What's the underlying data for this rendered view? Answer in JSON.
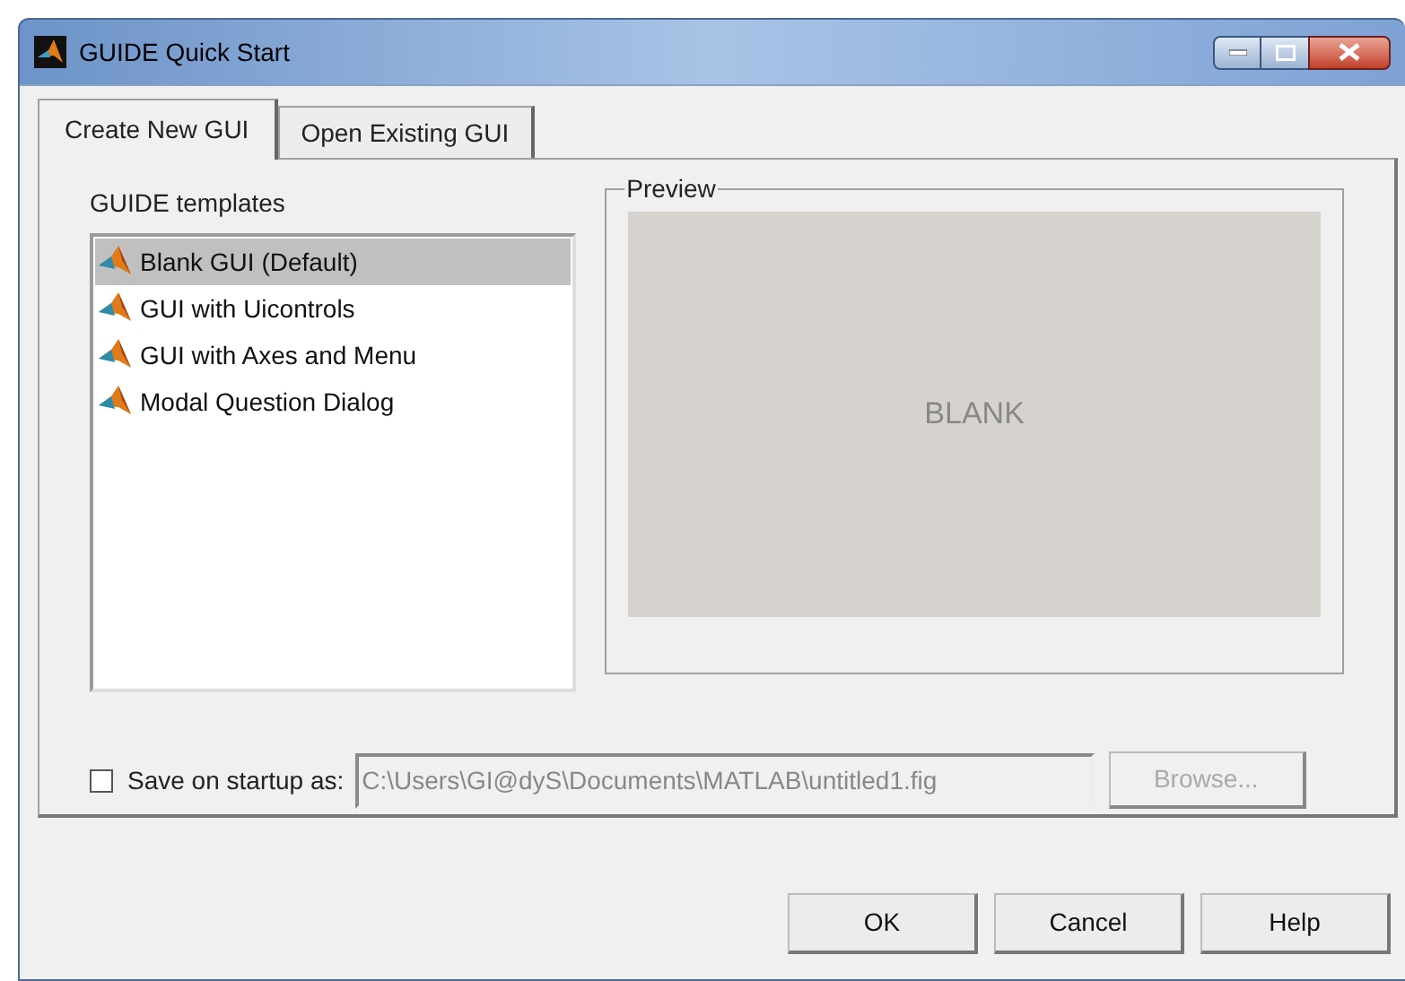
{
  "window": {
    "title": "GUIDE Quick Start"
  },
  "tabs": [
    {
      "label": "Create New GUI",
      "selected": true
    },
    {
      "label": "Open Existing GUI",
      "selected": false
    }
  ],
  "templates": {
    "label": "GUIDE templates",
    "items": [
      {
        "label": "Blank GUI (Default)",
        "selected": true
      },
      {
        "label": "GUI with Uicontrols",
        "selected": false
      },
      {
        "label": "GUI with Axes and Menu",
        "selected": false
      },
      {
        "label": "Modal Question Dialog",
        "selected": false
      }
    ]
  },
  "preview": {
    "label": "Preview",
    "text": "BLANK"
  },
  "save_on_startup": {
    "label": "Save on startup as:",
    "checked": false,
    "value": "C:\\Users\\GI@dyS\\Documents\\MATLAB\\untitled1.fig",
    "browse": "Browse...",
    "disabled": true
  },
  "buttons": [
    "OK",
    "Cancel",
    "Help"
  ]
}
